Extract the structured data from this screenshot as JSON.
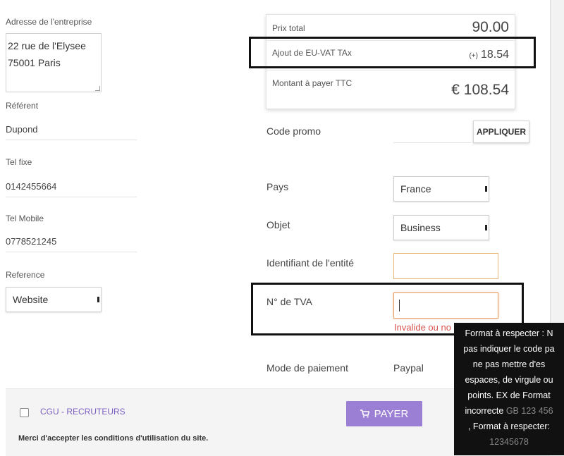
{
  "left": {
    "company_address_label": "Adresse de l'entreprise",
    "company_address_line1": "22 rue de l'Elysee",
    "company_address_line2": "75001 Paris",
    "referent_label": "Référent",
    "referent_value": "Dupond",
    "tel_fixe_label": "Tel fixe",
    "tel_fixe_value": "0142455664",
    "tel_mobile_label": "Tel Mobile",
    "tel_mobile_value": "0778521245",
    "reference_label": "Reference",
    "reference_value": "Website"
  },
  "summary": {
    "total_label": "Prix total",
    "total_value": "90.00",
    "vat_label": "Ajout de EU-VAT TAx",
    "vat_prefix": "(+)",
    "vat_value": "18.54",
    "amount_label": "Montant à payer TTC",
    "amount_value": "€ 108.54"
  },
  "form": {
    "promo_label": "Code promo",
    "promo_placeholder": "",
    "apply_button": "APPLIQUER",
    "country_label": "Pays",
    "country_value": "France",
    "object_label": "Objet",
    "object_value": "Business",
    "entity_label": "Identifiant de l'entité",
    "entity_value": "",
    "vat_number_label": "N° de TVA",
    "vat_number_value": "",
    "vat_error": "Invalide ou no",
    "payment_label": "Mode de paiement",
    "payment_value": "Paypal"
  },
  "footer": {
    "cgu_link": "CGU - RECRUTEURS",
    "accept_text": "Merci d'accepter les conditions d'utilisation du site.",
    "pay_button": "PAYER",
    "pay_icon": "cart-icon"
  },
  "tooltip": {
    "line1": "Format à respecter : N",
    "line2": "pas indiquer le code pa",
    "line3": "ne pas mettre d'es",
    "line4": "espaces, de virgule ou",
    "line5": "points. EX de Format",
    "line6_prefix": "incorrecte",
    "line6_example": "GB 123 456",
    "line7": ", Format à respecter:",
    "line8": "12345678"
  },
  "colors": {
    "accent": "#9b7fd4",
    "error": "#d9534f",
    "input_warning_border": "#e8b77a"
  }
}
